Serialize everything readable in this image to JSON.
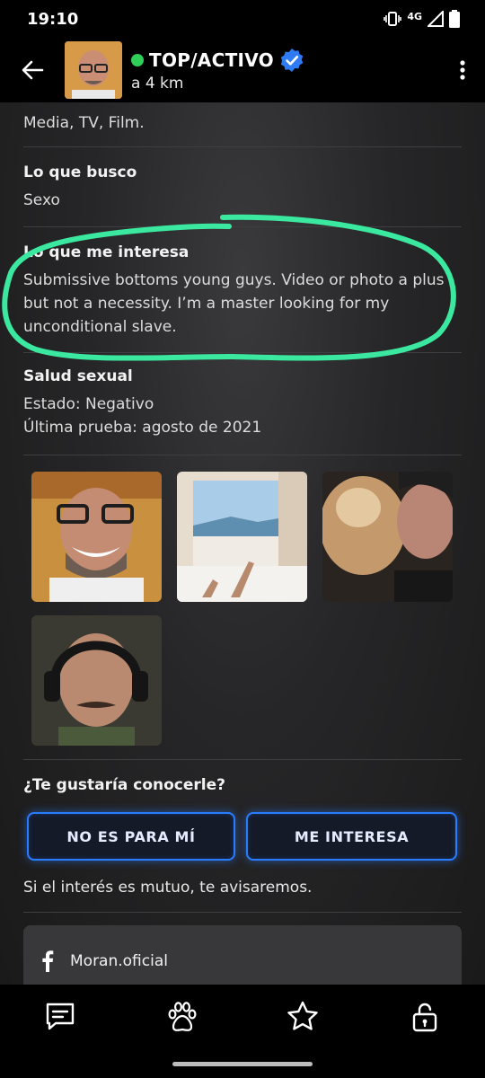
{
  "status_bar": {
    "time": "19:10",
    "network": "4G"
  },
  "header": {
    "name": "TOP/ACTIVO",
    "distance": "a 4 km",
    "online_color": "#2fcf5a",
    "verified_color": "#2f7bf5"
  },
  "profile": {
    "partial_line": "Media, TV, Film.",
    "sections": [
      {
        "title": "Lo que busco",
        "lines": [
          "Sexo"
        ]
      },
      {
        "title": "Lo que me interesa",
        "lines": [
          "Submissive bottoms young guys. Video or photo a plus but not a necessity. I’m a master looking for my unconditional slave."
        ]
      },
      {
        "title": "Salud sexual",
        "lines": [
          "Estado: Negativo",
          "Última prueba: agosto de 2021"
        ]
      }
    ],
    "highlight_color": "#3be8a0"
  },
  "photos": [
    {
      "name": "photo-1-smiling-man-glasses"
    },
    {
      "name": "photo-2-bedroom-window-sea"
    },
    {
      "name": "photo-3-selfie-with-dog"
    },
    {
      "name": "photo-4-man-headphones"
    }
  ],
  "cta": {
    "question": "¿Te gustaría conocerle?",
    "decline_label": "NO ES PARA MÍ",
    "accept_label": "ME INTERESA",
    "mutual_note": "Si el interés es mutuo, te avisaremos.",
    "button_color": "#2a7cff"
  },
  "social": {
    "icon": "facebook-icon",
    "label": "Moran.oficial"
  },
  "bottom_nav": [
    {
      "icon": "chat-icon"
    },
    {
      "icon": "paw-icon"
    },
    {
      "icon": "star-icon"
    },
    {
      "icon": "lock-icon"
    }
  ]
}
